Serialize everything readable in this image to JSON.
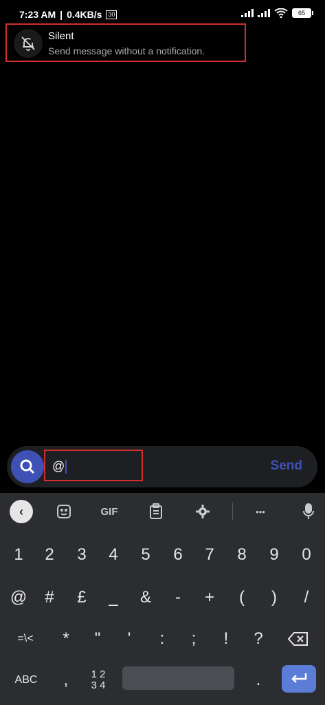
{
  "status_bar": {
    "time": "7:23 AM",
    "separator": "|",
    "speed": "0.4KB/s",
    "badge": "30",
    "battery": "65"
  },
  "suggestion": {
    "icon": "bell-off-icon",
    "title": "Silent",
    "description": "Send message without a notification."
  },
  "composer": {
    "input_value": "@",
    "send_label": "Send"
  },
  "keyboard": {
    "toolbar": {
      "gif_label": "GIF",
      "more_label": "•••"
    },
    "row1": [
      "1",
      "2",
      "3",
      "4",
      "5",
      "6",
      "7",
      "8",
      "9",
      "0"
    ],
    "row2": [
      "@",
      "#",
      "£",
      "_",
      "&",
      "-",
      "+",
      "(",
      ")",
      "/"
    ],
    "row3": [
      "=\\<",
      "*",
      "\"",
      "'",
      ":",
      ";",
      "!",
      "?"
    ],
    "row4": {
      "abc": "ABC",
      "comma": ",",
      "numpad_top": "1 2",
      "numpad_bottom": "3 4",
      "period": "."
    }
  },
  "colors": {
    "accent": "#3f51b5",
    "highlight_border": "#d32f2f",
    "keyboard_bg": "#2b2d31",
    "enter_key": "#5c7dd7"
  }
}
